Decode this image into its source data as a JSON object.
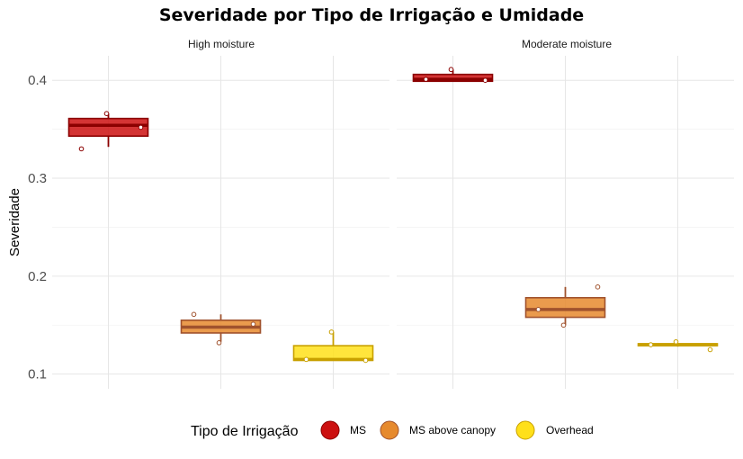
{
  "chart_data": {
    "type": "boxplot",
    "title": "Severidade por Tipo de Irrigação e Umidade",
    "ylabel": "Severidade",
    "xlabel": "",
    "ylim": [
      0.085,
      0.425
    ],
    "y_ticks": [
      0.1,
      0.2,
      0.3,
      0.4
    ],
    "grid": true,
    "legend": {
      "title": "Tipo de Irrigação",
      "position": "bottom",
      "entries": [
        {
          "label": "MS",
          "fill": "#cc1010",
          "stroke": "#8b0000"
        },
        {
          "label": "MS above canopy",
          "fill": "#e68a2e",
          "stroke": "#a0522d"
        },
        {
          "label": "Overhead",
          "fill": "#ffe01a",
          "stroke": "#c8a000"
        }
      ]
    },
    "categories": [
      "MS",
      "MS above canopy",
      "Overhead"
    ],
    "panels": [
      {
        "label": "High moisture",
        "boxes": [
          {
            "category": "MS",
            "min": 0.332,
            "q1": 0.343,
            "median": 0.354,
            "q3": 0.361,
            "max": 0.366,
            "points": [
              0.366,
              0.352,
              0.33
            ]
          },
          {
            "category": "MS above canopy",
            "min": 0.133,
            "q1": 0.142,
            "median": 0.148,
            "q3": 0.155,
            "max": 0.161,
            "points": [
              0.132,
              0.151,
              0.161
            ]
          },
          {
            "category": "Overhead",
            "min": 0.114,
            "q1": 0.114,
            "median": 0.115,
            "q3": 0.129,
            "max": 0.143,
            "points": [
              0.143,
              0.114,
              0.115
            ]
          }
        ]
      },
      {
        "label": "Moderate moisture",
        "boxes": [
          {
            "category": "MS",
            "min": 0.399,
            "q1": 0.399,
            "median": 0.401,
            "q3": 0.406,
            "max": 0.411,
            "points": [
              0.411,
              0.4,
              0.401
            ]
          },
          {
            "category": "MS above canopy",
            "min": 0.15,
            "q1": 0.158,
            "median": 0.166,
            "q3": 0.178,
            "max": 0.189,
            "points": [
              0.15,
              0.189,
              0.166
            ]
          },
          {
            "category": "Overhead",
            "min": 0.128,
            "q1": 0.129,
            "median": 0.13,
            "q3": 0.131,
            "max": 0.131,
            "points": [
              0.133,
              0.125,
              0.13
            ]
          }
        ]
      }
    ]
  }
}
